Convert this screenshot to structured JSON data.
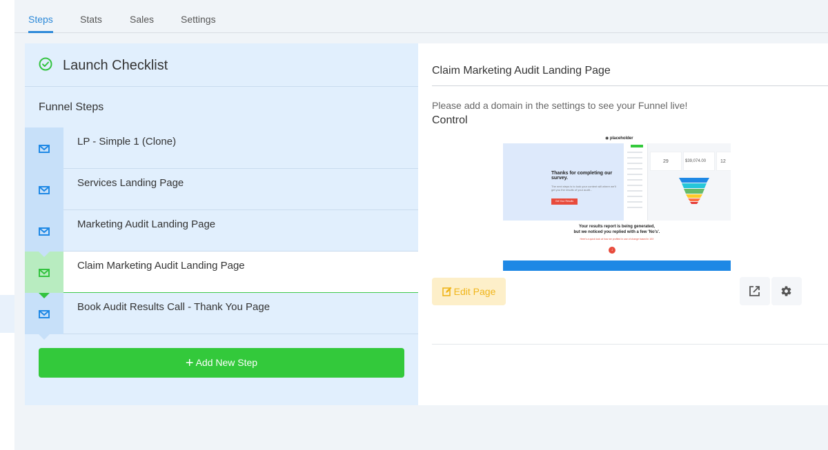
{
  "tabs": [
    {
      "label": "Steps",
      "active": true
    },
    {
      "label": "Stats",
      "active": false
    },
    {
      "label": "Sales",
      "active": false
    },
    {
      "label": "Settings",
      "active": false
    }
  ],
  "checklist": {
    "title": "Launch Checklist",
    "icon": "check-circle-icon",
    "color": "#33c33f"
  },
  "funnel": {
    "label": "Funnel Steps",
    "steps": [
      {
        "label": "LP - Simple 1 (Clone)",
        "icon": "envelope-icon",
        "active": false
      },
      {
        "label": "Services Landing Page",
        "icon": "envelope-icon",
        "active": false
      },
      {
        "label": "Marketing Audit Landing Page",
        "icon": "envelope-icon",
        "active": false
      },
      {
        "label": "Claim Marketing Audit Landing Page",
        "icon": "envelope-icon",
        "active": true
      },
      {
        "label": "Book Audit Results Call - Thank You Page",
        "icon": "envelope-icon",
        "active": false
      }
    ],
    "add_step_label": "Add New Step",
    "add_step_color": "#33c93b"
  },
  "detail": {
    "page_title": "Claim Marketing Audit Landing Page",
    "domain_note": "Please add a domain in the settings to see your Funnel live!",
    "variant_label": "Control",
    "edit_label": "Edit Page",
    "edit_color": "#f0b51a",
    "open_icon": "external-link-icon",
    "settings_icon": "gear-icon"
  },
  "preview": {
    "logo": "placeholder",
    "hero_title": "Thanks for completing our survey.",
    "hero_sub": "The next steps is to look your content will where we'll get you the results of your audit...",
    "hero_button": "Get Your Results",
    "stat1": "29",
    "stat2": "$39,074.00",
    "stat3": "12",
    "report_line1": "Your results report is being generated,",
    "report_line2": "but we noticed you replied with a few 'No's'.",
    "report_note": "Here's a quick look at how we profited in use of change based in 10X"
  }
}
